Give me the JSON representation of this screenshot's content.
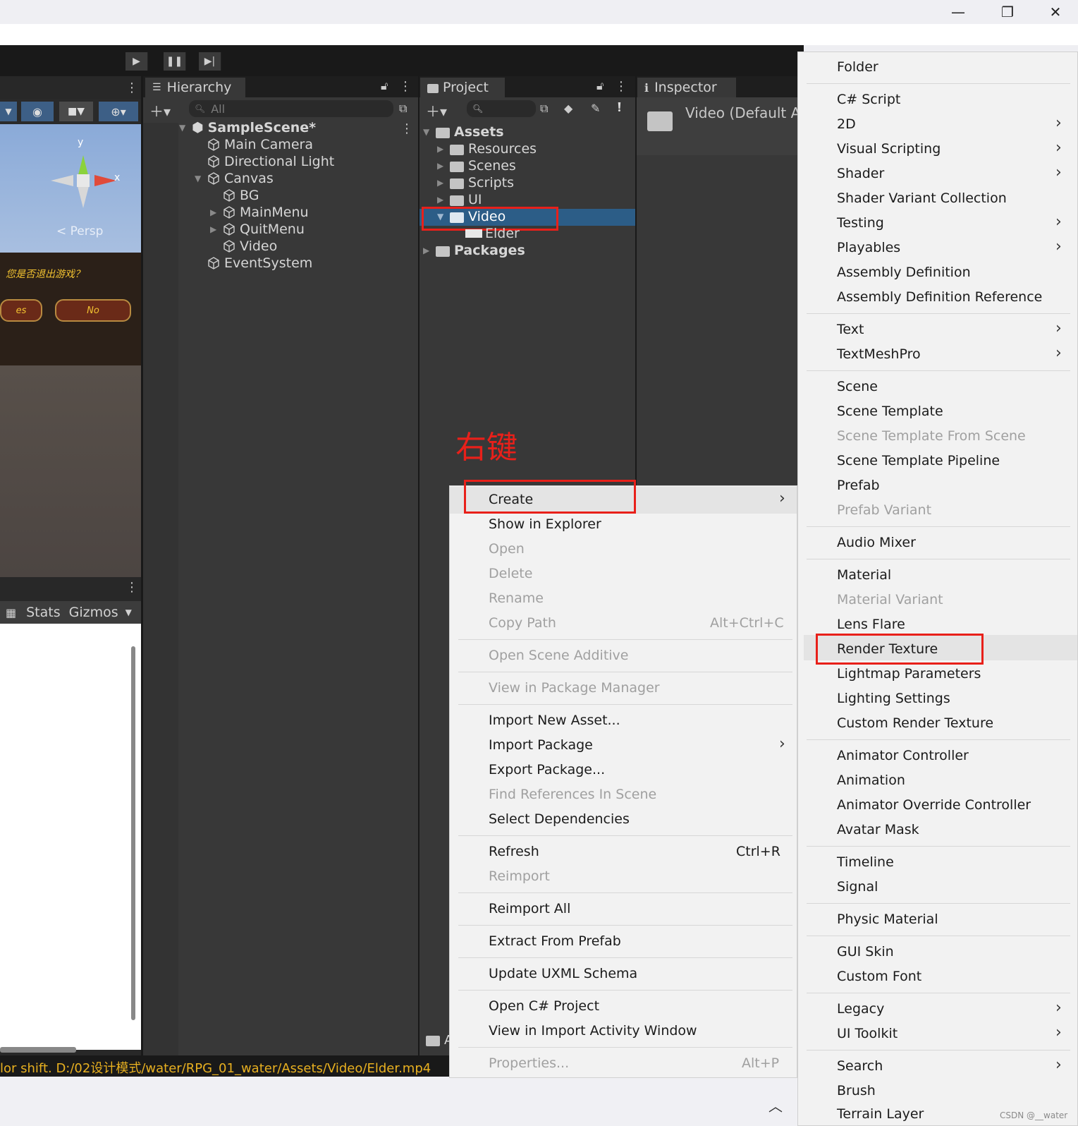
{
  "window": {
    "minimize_icon": "minimize-icon",
    "restore_icon": "restore-icon",
    "close_icon": "close-icon"
  },
  "scene_view": {
    "axis_y": "y",
    "axis_x": "x",
    "persp_label": "Persp",
    "game_question": "您是否退出游戏？",
    "btn_yes": "es",
    "btn_no": "No",
    "stats_label": "Stats",
    "gizmos_label": "Gizmos"
  },
  "hierarchy": {
    "tab_label": "Hierarchy",
    "search_placeholder": "All",
    "scene_name": "SampleScene*",
    "items": [
      "Main Camera",
      "Directional Light",
      "Canvas",
      "BG",
      "MainMenu",
      "QuitMenu",
      "Video",
      "EventSystem"
    ]
  },
  "project": {
    "tab_label": "Project",
    "assets_label": "Assets",
    "folders": [
      "Resources",
      "Scenes",
      "Scripts",
      "UI",
      "Video"
    ],
    "video_child": "Elder",
    "packages_label": "Packages",
    "annotation": "右键",
    "bottom_folder": "A"
  },
  "inspector": {
    "tab_label": "Inspector",
    "title": "Video (Default A"
  },
  "context_menu": {
    "create": "Create",
    "show_in_explorer": "Show in Explorer",
    "open": "Open",
    "delete": "Delete",
    "rename": "Rename",
    "copy_path": "Copy Path",
    "copy_path_shortcut": "Alt+Ctrl+C",
    "open_scene_additive": "Open Scene Additive",
    "view_in_package_manager": "View in Package Manager",
    "import_new_asset": "Import New Asset...",
    "import_package": "Import Package",
    "export_package": "Export Package...",
    "find_references": "Find References In Scene",
    "select_dependencies": "Select Dependencies",
    "refresh": "Refresh",
    "refresh_shortcut": "Ctrl+R",
    "reimport": "Reimport",
    "reimport_all": "Reimport All",
    "extract_from_prefab": "Extract From Prefab",
    "update_uxml": "Update UXML Schema",
    "open_csharp_project": "Open C# Project",
    "view_import_activity": "View in Import Activity Window",
    "properties": "Properties...",
    "properties_shortcut": "Alt+P"
  },
  "create_menu": {
    "folder": "Folder",
    "csharp_script": "C# Script",
    "two_d": "2D",
    "visual_scripting": "Visual Scripting",
    "shader": "Shader",
    "shader_variant_collection": "Shader Variant Collection",
    "testing": "Testing",
    "playables": "Playables",
    "assembly_definition": "Assembly Definition",
    "assembly_definition_reference": "Assembly Definition Reference",
    "text": "Text",
    "textmeshpro": "TextMeshPro",
    "scene": "Scene",
    "scene_template": "Scene Template",
    "scene_template_from_scene": "Scene Template From Scene",
    "scene_template_pipeline": "Scene Template Pipeline",
    "prefab": "Prefab",
    "prefab_variant": "Prefab Variant",
    "audio_mixer": "Audio Mixer",
    "material": "Material",
    "material_variant": "Material Variant",
    "lens_flare": "Lens Flare",
    "render_texture": "Render Texture",
    "lightmap_parameters": "Lightmap Parameters",
    "lighting_settings": "Lighting Settings",
    "custom_render_texture": "Custom Render Texture",
    "animator_controller": "Animator Controller",
    "animation": "Animation",
    "animator_override_controller": "Animator Override Controller",
    "avatar_mask": "Avatar Mask",
    "timeline": "Timeline",
    "signal": "Signal",
    "physic_material": "Physic Material",
    "gui_skin": "GUI Skin",
    "custom_font": "Custom Font",
    "legacy": "Legacy",
    "ui_toolkit": "UI Toolkit",
    "search": "Search",
    "brush": "Brush",
    "terrain_layer": "Terrain Layer"
  },
  "status_bar": {
    "message": "lor shift. D:/02设计模式/water/RPG_01_water/Assets/Video/Elder.mp4"
  },
  "watermark": "CSDN @__water",
  "colors": {
    "selection": "#2c5d87",
    "annotation_red": "#e8201a",
    "status_text": "#e8b020"
  }
}
